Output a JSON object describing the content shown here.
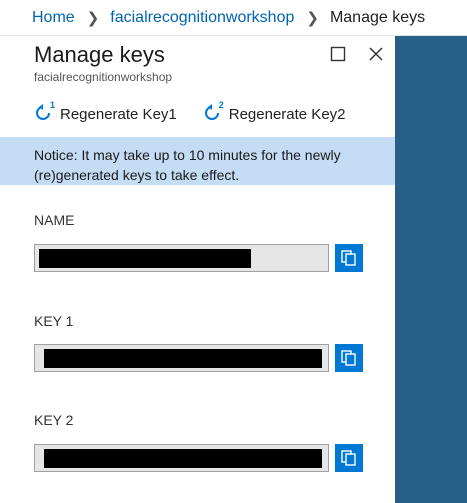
{
  "breadcrumb": {
    "home": "Home",
    "resource": "facialrecognitionworkshop",
    "current": "Manage keys"
  },
  "blade": {
    "title": "Manage keys",
    "subtitle": "facialrecognitionworkshop"
  },
  "toolbar": {
    "regen1_label": "Regenerate Key1",
    "regen2_label": "Regenerate Key2",
    "regen1_badge": "1",
    "regen2_badge": "2"
  },
  "notice": {
    "text": "Notice: It may take up to 10 minutes for the newly (re)generated keys to take effect."
  },
  "fields": [
    {
      "label": "NAME",
      "value_redacted": true
    },
    {
      "label": "KEY 1",
      "value_redacted": true
    },
    {
      "label": "KEY 2",
      "value_redacted": true
    }
  ],
  "colors": {
    "accent": "#0078d4",
    "link": "#0063b1",
    "notice_bg": "#c5dcf5",
    "side_panel": "#285f88"
  },
  "icons": {
    "maximize": "maximize-icon",
    "close": "close-icon",
    "regenerate": "refresh-icon",
    "copy": "copy-icon"
  }
}
